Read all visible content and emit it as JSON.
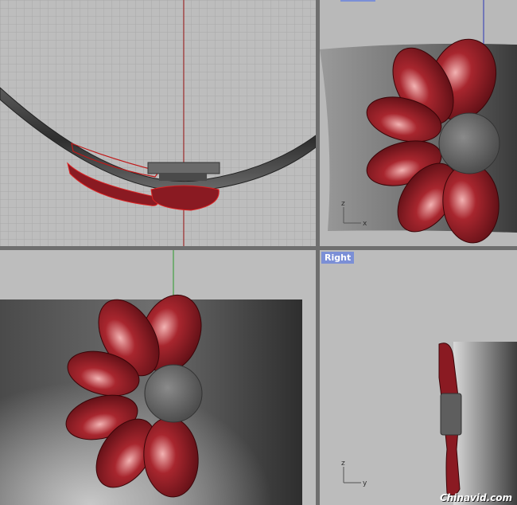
{
  "viewports": {
    "top": {
      "label": ""
    },
    "front": {
      "label": ""
    },
    "perspective": {
      "label": ""
    },
    "right": {
      "label": "Right"
    }
  },
  "axes": {
    "front": {
      "vertical": "z",
      "horizontal": "x"
    },
    "right": {
      "vertical": "z",
      "horizontal": "y"
    }
  },
  "watermark": "Chinavid.com",
  "colors": {
    "petal": "#8a1a22",
    "hub": "#6a6a6a",
    "grid": "#a8a8a8",
    "x_axis": "#b31515",
    "y_axis": "#2a9a2a",
    "z_axis": "#2a35b5",
    "label_bg": "#7b8fd6"
  }
}
